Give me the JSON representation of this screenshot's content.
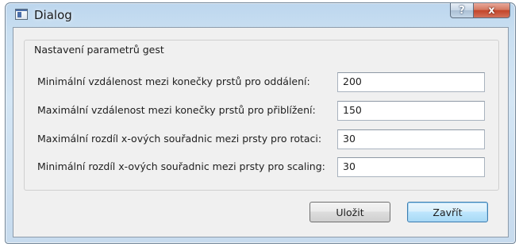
{
  "window": {
    "title": "Dialog",
    "help_label": "?",
    "close_label": "x"
  },
  "group": {
    "title": "Nastavení parametrů gest"
  },
  "rows": [
    {
      "label": "Minimální vzdálenost mezi konečky prstů pro oddálení:",
      "value": "200"
    },
    {
      "label": "Maximální vzdálenost mezi konečky prstů pro přiblížení:",
      "value": "150"
    },
    {
      "label": "Maximální rozdíl x-ových souřadnic mezi prsty pro rotaci:",
      "value": "30"
    },
    {
      "label": "Minimální rozdíl x-ových souřadnic mezi prsty pro scaling:",
      "value": "30"
    }
  ],
  "buttons": {
    "save": "Uložit",
    "close": "Zavřít"
  },
  "colors": {
    "title_bar": "#c9dff1",
    "close_button": "#c3452a",
    "focused_button_border": "#3c7fb1"
  }
}
